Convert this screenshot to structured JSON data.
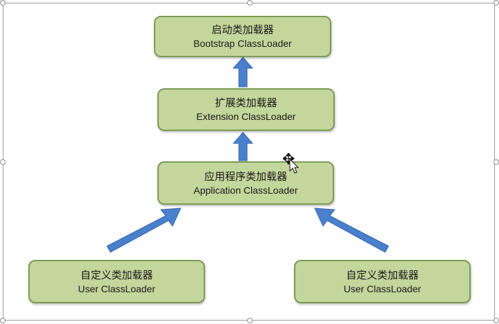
{
  "colors": {
    "node_fill": "#c3d69b",
    "node_border": "#7a9a55",
    "arrow": "#4a7fcc"
  },
  "nodes": {
    "bootstrap": {
      "zh": "启动类加载器",
      "en": "Bootstrap ClassLoader"
    },
    "extension": {
      "zh": "扩展类加载器",
      "en": "Extension ClassLoader"
    },
    "application": {
      "zh": "应用程序类加载器",
      "en": "Application ClassLoader"
    },
    "user_left": {
      "zh": "自定义类加载器",
      "en": "User ClassLoader"
    },
    "user_right": {
      "zh": "自定义类加载器",
      "en": "User ClassLoader"
    }
  },
  "icons": {
    "cursor": "move-cursor-icon",
    "selection": "selection-handle-icon"
  }
}
